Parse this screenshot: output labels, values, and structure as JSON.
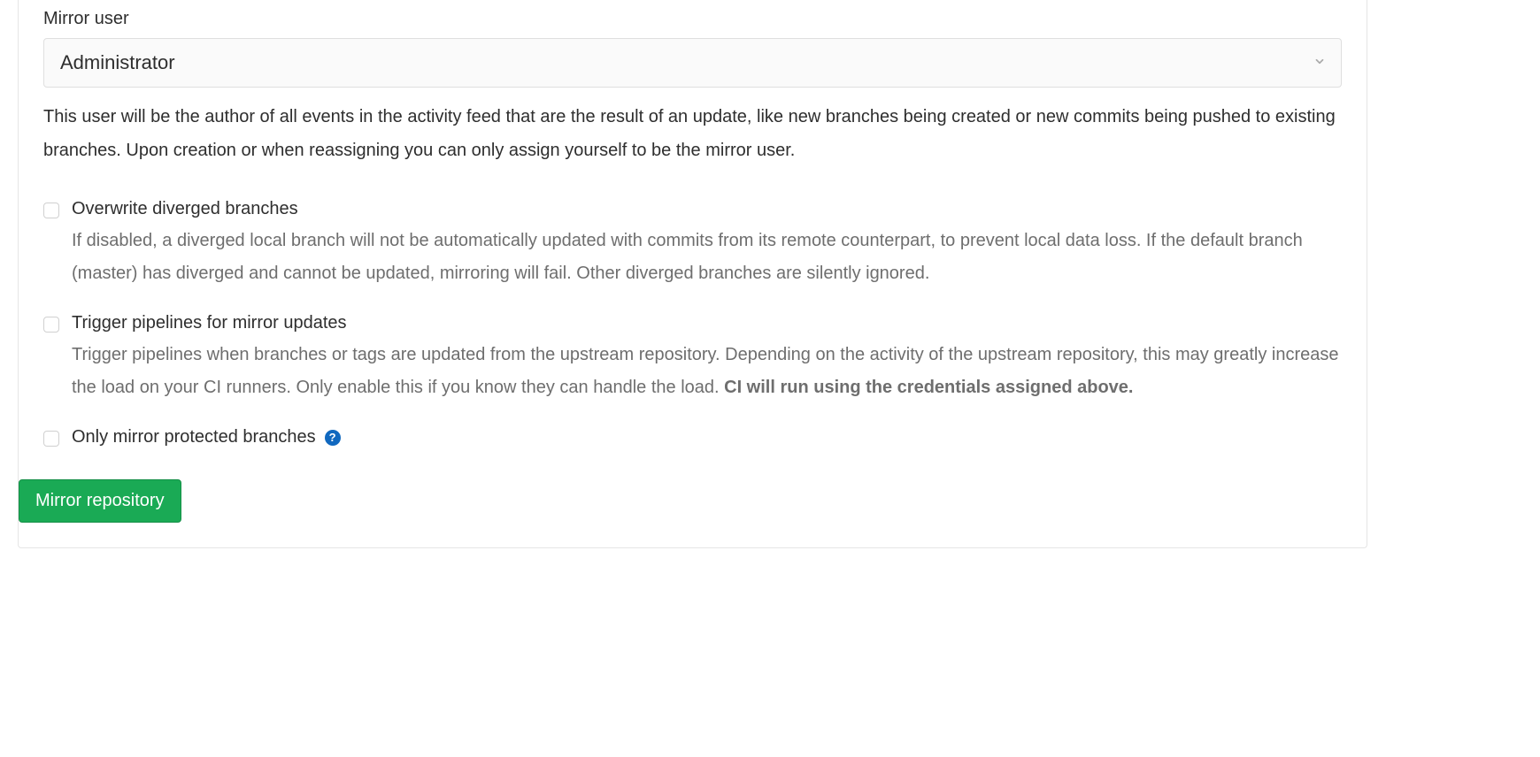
{
  "mirror_user": {
    "label": "Mirror user",
    "selected": "Administrator",
    "description": "This user will be the author of all events in the activity feed that are the result of an update, like new branches being created or new commits being pushed to existing branches. Upon creation or when reassigning you can only assign yourself to be the mirror user."
  },
  "checkboxes": {
    "overwrite": {
      "label": "Overwrite diverged branches",
      "description": "If disabled, a diverged local branch will not be automatically updated with commits from its remote counterpart, to prevent local data loss. If the default branch (master) has diverged and cannot be updated, mirroring will fail. Other diverged branches are silently ignored."
    },
    "trigger": {
      "label": "Trigger pipelines for mirror updates",
      "description_pre": "Trigger pipelines when branches or tags are updated from the upstream repository. Depending on the activity of the upstream repository, this may greatly increase the load on your CI runners. Only enable this if you know they can handle the load. ",
      "description_strong": "CI will run using the credentials assigned above."
    },
    "protected": {
      "label": "Only mirror protected branches"
    }
  },
  "submit": {
    "label": "Mirror repository"
  }
}
